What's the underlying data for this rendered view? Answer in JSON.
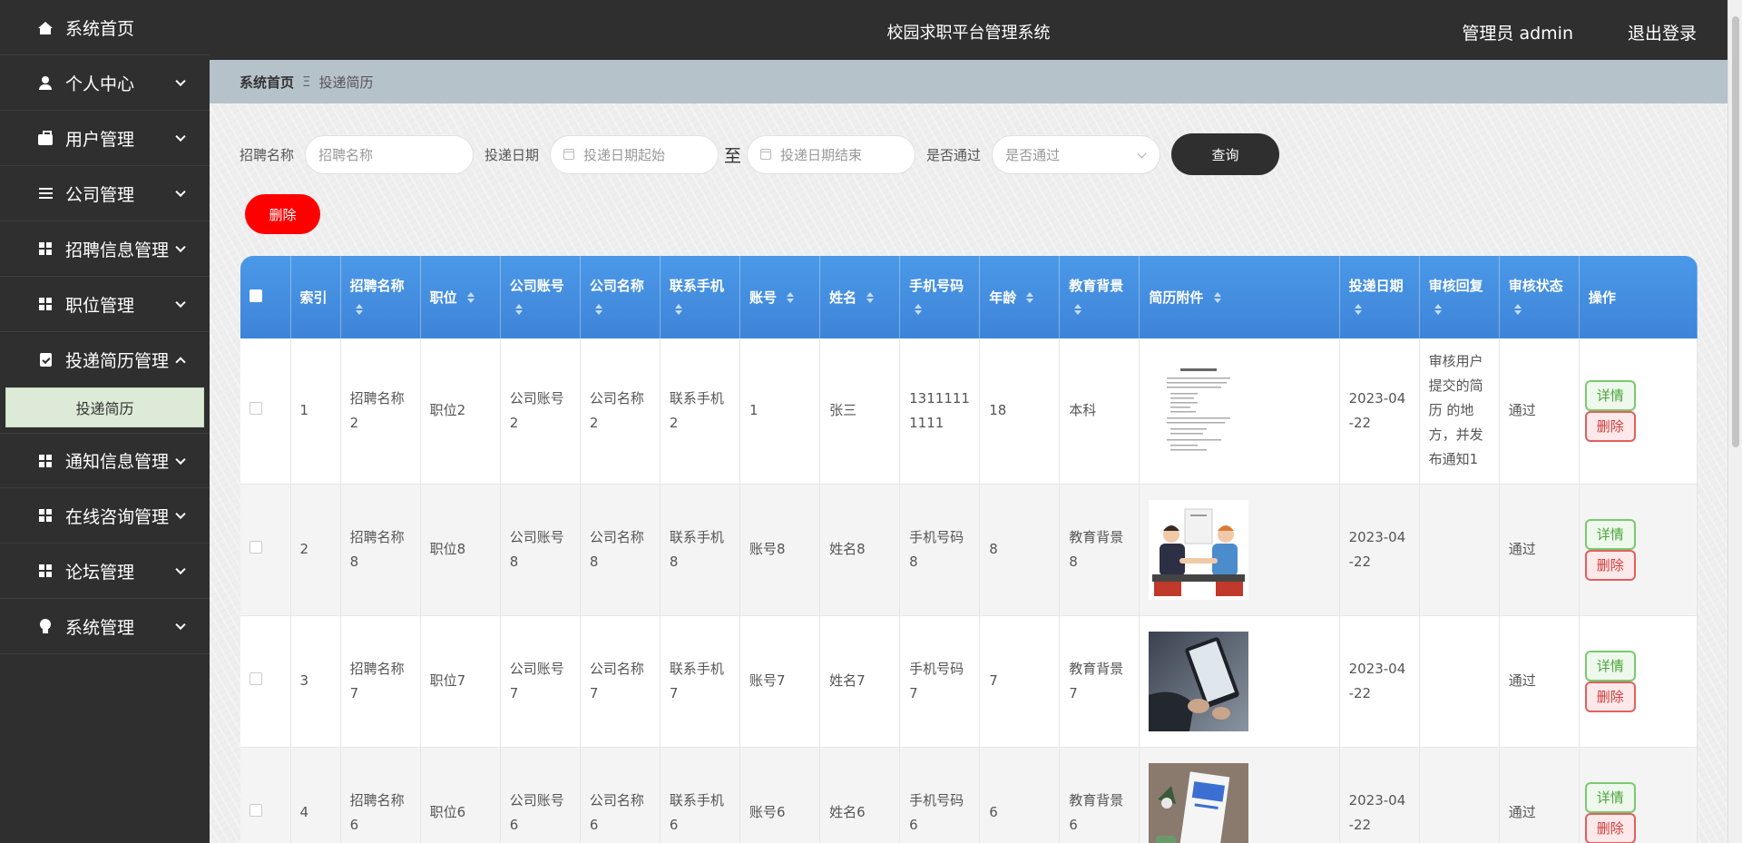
{
  "app_title": "校园求职平台管理系统",
  "header": {
    "user_label": "管理员 admin",
    "logout_label": "退出登录"
  },
  "sidebar": {
    "items": [
      {
        "label": "系统首页",
        "icon": "home-icon",
        "has_chevron": false
      },
      {
        "label": "个人中心",
        "icon": "person-icon",
        "has_chevron": true
      },
      {
        "label": "用户管理",
        "icon": "briefcase-icon",
        "has_chevron": true
      },
      {
        "label": "公司管理",
        "icon": "list-icon",
        "has_chevron": true
      },
      {
        "label": "招聘信息管理",
        "icon": "grid-icon",
        "has_chevron": true
      },
      {
        "label": "职位管理",
        "icon": "grid-icon",
        "has_chevron": true
      },
      {
        "label": "投递简历管理",
        "icon": "clipboard-icon",
        "has_chevron": true,
        "expanded": true,
        "children": [
          {
            "label": "投递简历"
          }
        ]
      },
      {
        "label": "通知信息管理",
        "icon": "grid-icon",
        "has_chevron": true
      },
      {
        "label": "在线咨询管理",
        "icon": "grid-icon",
        "has_chevron": true
      },
      {
        "label": "论坛管理",
        "icon": "grid-icon",
        "has_chevron": true
      },
      {
        "label": "系统管理",
        "icon": "bulb-icon",
        "has_chevron": true
      }
    ]
  },
  "breadcrumb": {
    "home": "系统首页",
    "separator": "Ξ",
    "current": "投递简历"
  },
  "search": {
    "name_label": "招聘名称",
    "name_placeholder": "招聘名称",
    "date_label": "投递日期",
    "date_start_placeholder": "投递日期起始",
    "date_to": "至",
    "date_end_placeholder": "投递日期结束",
    "pass_label": "是否通过",
    "pass_placeholder": "是否通过",
    "query_button": "查询"
  },
  "toolbar": {
    "delete_button": "删除"
  },
  "table": {
    "headers": [
      "索引",
      "招聘名称",
      "职位",
      "公司账号",
      "公司名称",
      "联系手机",
      "账号",
      "姓名",
      "手机号码",
      "年龄",
      "教育背景",
      "简历附件",
      "投递日期",
      "审核回复",
      "审核状态",
      "操作"
    ],
    "rows": [
      {
        "index": "1",
        "job_name": "招聘名称2",
        "position": "职位2",
        "company_account": "公司账号2",
        "company_name": "公司名称2",
        "contact_phone": "联系手机2",
        "account": "1",
        "name": "张三",
        "phone": "13111111111",
        "age": "18",
        "education": "本科",
        "attachment": "document-thumbnail",
        "date": "2023-04-22",
        "reply": "审核用户提交的简历 的地方，并发布通知1",
        "status": "通过",
        "detail": "详情",
        "delete": "删除"
      },
      {
        "index": "2",
        "job_name": "招聘名称8",
        "position": "职位8",
        "company_account": "公司账号8",
        "company_name": "公司名称8",
        "contact_phone": "联系手机8",
        "account": "账号8",
        "name": "姓名8",
        "phone": "手机号码8",
        "age": "8",
        "education": "教育背景8",
        "attachment": "handshake-thumbnail",
        "date": "2023-04-22",
        "reply": "",
        "status": "通过",
        "detail": "详情",
        "delete": "删除"
      },
      {
        "index": "3",
        "job_name": "招聘名称7",
        "position": "职位7",
        "company_account": "公司账号7",
        "company_name": "公司名称7",
        "contact_phone": "联系手机7",
        "account": "账号7",
        "name": "姓名7",
        "phone": "手机号码7",
        "age": "7",
        "education": "教育背景7",
        "attachment": "tablet-thumbnail",
        "date": "2023-04-22",
        "reply": "",
        "status": "通过",
        "detail": "详情",
        "delete": "删除"
      },
      {
        "index": "4",
        "job_name": "招聘名称6",
        "position": "职位6",
        "company_account": "公司账号6",
        "company_name": "公司名称6",
        "contact_phone": "联系手机6",
        "account": "账号6",
        "name": "姓名6",
        "phone": "手机号码6",
        "age": "6",
        "education": "教育背景6",
        "attachment": "brochure-thumbnail",
        "date": "2023-04-22",
        "reply": "",
        "status": "通过",
        "detail": "详情",
        "delete": "删除"
      }
    ]
  },
  "colors": {
    "sidebar_bg": "#2f2f2f",
    "header_bg": "#2f2f2f",
    "table_header": "#4b98e8",
    "delete_red": "#ff0000",
    "detail_green": "#4aa43a",
    "active_submenu": "#dcead7"
  }
}
